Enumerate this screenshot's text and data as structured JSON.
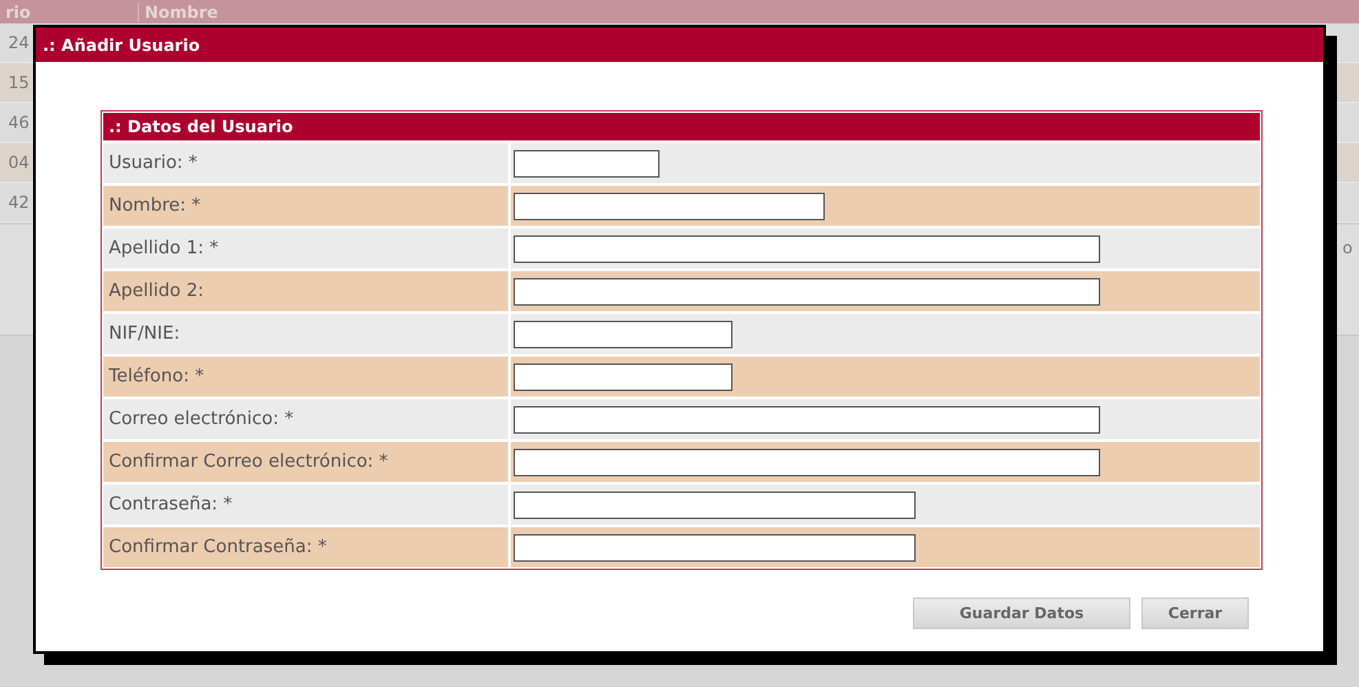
{
  "background_table": {
    "columns": [
      "rio",
      "Nombre"
    ],
    "rows": [
      "24",
      "15",
      "46",
      "04",
      "42"
    ],
    "column_3": "o"
  },
  "dialog": {
    "title": ".: Añadir Usuario",
    "panel_title": ".: Datos del Usuario",
    "fields": [
      {
        "label": "Usuario: *",
        "kind": "xs"
      },
      {
        "label": "Nombre: *",
        "kind": "m"
      },
      {
        "label": "Apellido 1: *",
        "kind": "xl"
      },
      {
        "label": "Apellido 2:",
        "kind": "xl"
      },
      {
        "label": "NIF/NIE:",
        "kind": "s"
      },
      {
        "label": "Teléfono: *",
        "kind": "s"
      },
      {
        "label": "Correo electrónico: *",
        "kind": "xl"
      },
      {
        "label": "Confirmar Correo electrónico: *",
        "kind": "xl"
      },
      {
        "label": "Contraseña: *",
        "kind": "l"
      },
      {
        "label": "Confirmar Contraseña: *",
        "kind": "l"
      }
    ],
    "buttons": [
      "Guardar Datos",
      "Cerrar"
    ]
  }
}
